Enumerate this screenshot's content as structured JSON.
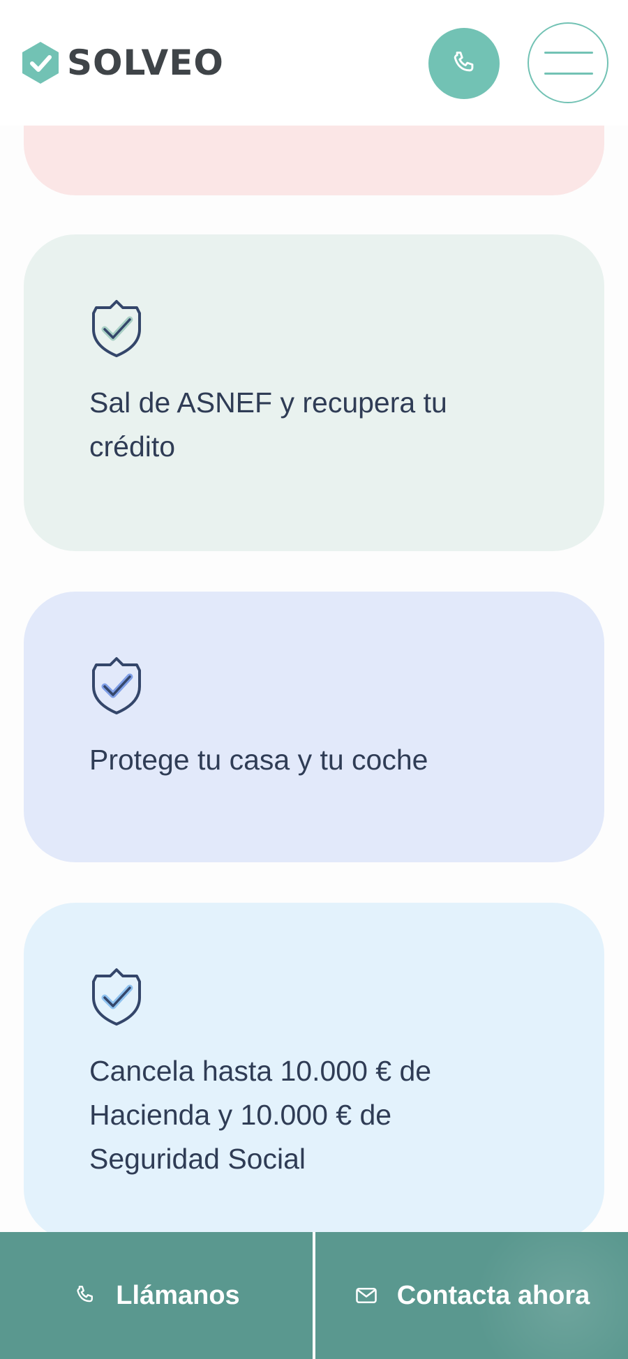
{
  "header": {
    "brand": "SOLVEO",
    "icons": {
      "logo": "check-hexagon-icon",
      "call": "phone-icon",
      "menu": "hamburger-menu-icon"
    }
  },
  "cards": [
    {
      "text": "",
      "color": "#fbe6e6"
    },
    {
      "text": "Sal de ASNEF y recupera tu crédito",
      "icon": "shield-check-icon",
      "color": "#e9f2ef",
      "check_color": "#a8cfc4"
    },
    {
      "text": "Protege tu casa y tu coche",
      "icon": "shield-check-icon",
      "color": "#e2e9fa",
      "check_color": "#7f9ee6"
    },
    {
      "text": "Cancela hasta 10.000 € de Hacienda y 10.000 € de Seguridad Social",
      "icon": "shield-check-icon",
      "color": "#e3f2fc",
      "check_color": "#8fc2ef"
    }
  ],
  "bottom_bar": {
    "call_label": "Llámanos",
    "contact_label": "Contacta ahora",
    "icons": {
      "call": "phone-icon",
      "contact": "envelope-icon"
    }
  },
  "colors": {
    "accent": "#72c2b4",
    "bar": "#5a988f",
    "text": "#2f3c55",
    "logo_text": "#3f4448"
  }
}
